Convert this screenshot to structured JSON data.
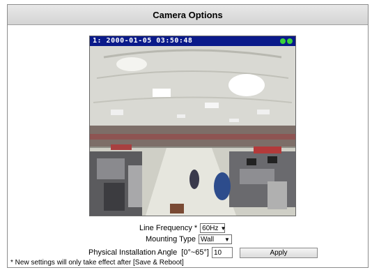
{
  "header": {
    "title": "Camera Options"
  },
  "camera": {
    "osd_text": "1: 2000-01-05 03:50:48",
    "status_icons": [
      "signal-icon",
      "signal-icon"
    ]
  },
  "form": {
    "line_frequency": {
      "label": "Line Frequency *",
      "value": "60Hz"
    },
    "mounting_type": {
      "label": "Mounting Type",
      "value": "Wall"
    },
    "install_angle": {
      "label": "Physical Installation Angle  [0°~65°]",
      "value": "10"
    },
    "apply_label": "Apply"
  },
  "footer": {
    "note": "* New settings will only take effect after [Save & Reboot]"
  }
}
